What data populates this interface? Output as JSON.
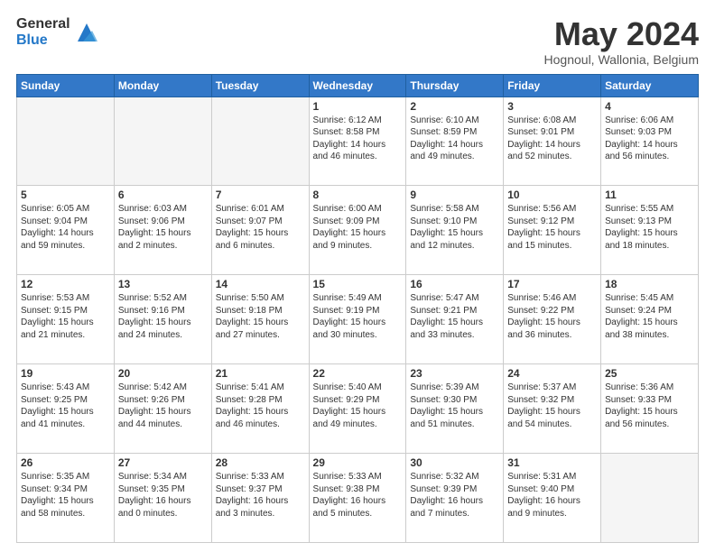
{
  "header": {
    "logo_general": "General",
    "logo_blue": "Blue",
    "month_title": "May 2024",
    "location": "Hognoul, Wallonia, Belgium"
  },
  "weekdays": [
    "Sunday",
    "Monday",
    "Tuesday",
    "Wednesday",
    "Thursday",
    "Friday",
    "Saturday"
  ],
  "weeks": [
    [
      {
        "day": "",
        "info": ""
      },
      {
        "day": "",
        "info": ""
      },
      {
        "day": "",
        "info": ""
      },
      {
        "day": "1",
        "info": "Sunrise: 6:12 AM\nSunset: 8:58 PM\nDaylight: 14 hours\nand 46 minutes."
      },
      {
        "day": "2",
        "info": "Sunrise: 6:10 AM\nSunset: 8:59 PM\nDaylight: 14 hours\nand 49 minutes."
      },
      {
        "day": "3",
        "info": "Sunrise: 6:08 AM\nSunset: 9:01 PM\nDaylight: 14 hours\nand 52 minutes."
      },
      {
        "day": "4",
        "info": "Sunrise: 6:06 AM\nSunset: 9:03 PM\nDaylight: 14 hours\nand 56 minutes."
      }
    ],
    [
      {
        "day": "5",
        "info": "Sunrise: 6:05 AM\nSunset: 9:04 PM\nDaylight: 14 hours\nand 59 minutes."
      },
      {
        "day": "6",
        "info": "Sunrise: 6:03 AM\nSunset: 9:06 PM\nDaylight: 15 hours\nand 2 minutes."
      },
      {
        "day": "7",
        "info": "Sunrise: 6:01 AM\nSunset: 9:07 PM\nDaylight: 15 hours\nand 6 minutes."
      },
      {
        "day": "8",
        "info": "Sunrise: 6:00 AM\nSunset: 9:09 PM\nDaylight: 15 hours\nand 9 minutes."
      },
      {
        "day": "9",
        "info": "Sunrise: 5:58 AM\nSunset: 9:10 PM\nDaylight: 15 hours\nand 12 minutes."
      },
      {
        "day": "10",
        "info": "Sunrise: 5:56 AM\nSunset: 9:12 PM\nDaylight: 15 hours\nand 15 minutes."
      },
      {
        "day": "11",
        "info": "Sunrise: 5:55 AM\nSunset: 9:13 PM\nDaylight: 15 hours\nand 18 minutes."
      }
    ],
    [
      {
        "day": "12",
        "info": "Sunrise: 5:53 AM\nSunset: 9:15 PM\nDaylight: 15 hours\nand 21 minutes."
      },
      {
        "day": "13",
        "info": "Sunrise: 5:52 AM\nSunset: 9:16 PM\nDaylight: 15 hours\nand 24 minutes."
      },
      {
        "day": "14",
        "info": "Sunrise: 5:50 AM\nSunset: 9:18 PM\nDaylight: 15 hours\nand 27 minutes."
      },
      {
        "day": "15",
        "info": "Sunrise: 5:49 AM\nSunset: 9:19 PM\nDaylight: 15 hours\nand 30 minutes."
      },
      {
        "day": "16",
        "info": "Sunrise: 5:47 AM\nSunset: 9:21 PM\nDaylight: 15 hours\nand 33 minutes."
      },
      {
        "day": "17",
        "info": "Sunrise: 5:46 AM\nSunset: 9:22 PM\nDaylight: 15 hours\nand 36 minutes."
      },
      {
        "day": "18",
        "info": "Sunrise: 5:45 AM\nSunset: 9:24 PM\nDaylight: 15 hours\nand 38 minutes."
      }
    ],
    [
      {
        "day": "19",
        "info": "Sunrise: 5:43 AM\nSunset: 9:25 PM\nDaylight: 15 hours\nand 41 minutes."
      },
      {
        "day": "20",
        "info": "Sunrise: 5:42 AM\nSunset: 9:26 PM\nDaylight: 15 hours\nand 44 minutes."
      },
      {
        "day": "21",
        "info": "Sunrise: 5:41 AM\nSunset: 9:28 PM\nDaylight: 15 hours\nand 46 minutes."
      },
      {
        "day": "22",
        "info": "Sunrise: 5:40 AM\nSunset: 9:29 PM\nDaylight: 15 hours\nand 49 minutes."
      },
      {
        "day": "23",
        "info": "Sunrise: 5:39 AM\nSunset: 9:30 PM\nDaylight: 15 hours\nand 51 minutes."
      },
      {
        "day": "24",
        "info": "Sunrise: 5:37 AM\nSunset: 9:32 PM\nDaylight: 15 hours\nand 54 minutes."
      },
      {
        "day": "25",
        "info": "Sunrise: 5:36 AM\nSunset: 9:33 PM\nDaylight: 15 hours\nand 56 minutes."
      }
    ],
    [
      {
        "day": "26",
        "info": "Sunrise: 5:35 AM\nSunset: 9:34 PM\nDaylight: 15 hours\nand 58 minutes."
      },
      {
        "day": "27",
        "info": "Sunrise: 5:34 AM\nSunset: 9:35 PM\nDaylight: 16 hours\nand 0 minutes."
      },
      {
        "day": "28",
        "info": "Sunrise: 5:33 AM\nSunset: 9:37 PM\nDaylight: 16 hours\nand 3 minutes."
      },
      {
        "day": "29",
        "info": "Sunrise: 5:33 AM\nSunset: 9:38 PM\nDaylight: 16 hours\nand 5 minutes."
      },
      {
        "day": "30",
        "info": "Sunrise: 5:32 AM\nSunset: 9:39 PM\nDaylight: 16 hours\nand 7 minutes."
      },
      {
        "day": "31",
        "info": "Sunrise: 5:31 AM\nSunset: 9:40 PM\nDaylight: 16 hours\nand 9 minutes."
      },
      {
        "day": "",
        "info": ""
      }
    ]
  ]
}
